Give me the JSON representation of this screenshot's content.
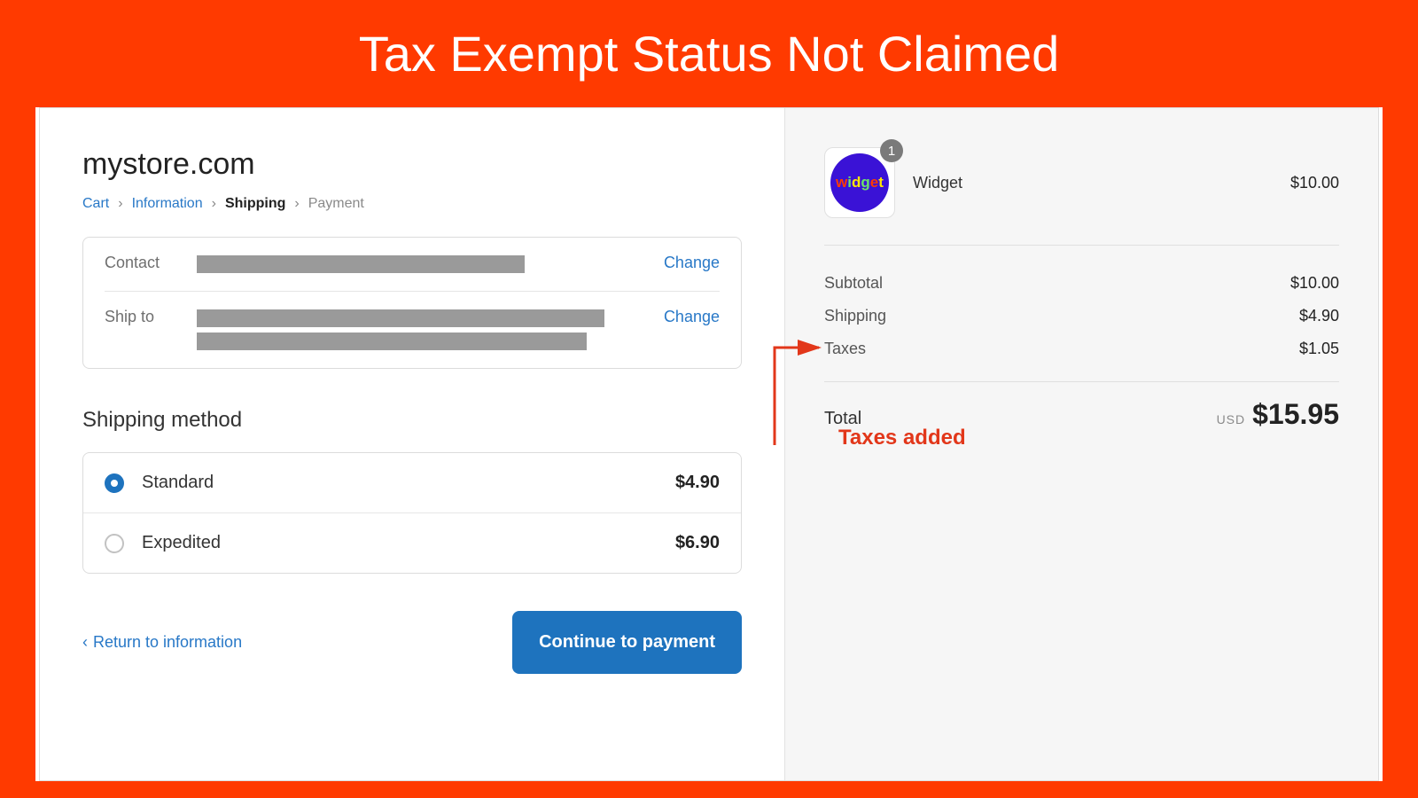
{
  "slide": {
    "title": "Tax Exempt Status Not Claimed"
  },
  "store": {
    "name": "mystore.com"
  },
  "breadcrumb": {
    "cart": "Cart",
    "information": "Information",
    "shipping": "Shipping",
    "payment": "Payment"
  },
  "info": {
    "contact_label": "Contact",
    "shipto_label": "Ship to",
    "change": "Change"
  },
  "shipping": {
    "heading": "Shipping method",
    "standard": {
      "name": "Standard",
      "price": "$4.90"
    },
    "expedited": {
      "name": "Expedited",
      "price": "$6.90"
    }
  },
  "actions": {
    "return": "Return to information",
    "continue": "Continue to payment"
  },
  "cart": {
    "badge": "1",
    "item_name": "Widget",
    "item_price": "$10.00"
  },
  "summary": {
    "subtotal_label": "Subtotal",
    "subtotal_value": "$10.00",
    "shipping_label": "Shipping",
    "shipping_value": "$4.90",
    "taxes_label": "Taxes",
    "taxes_value": "$1.05",
    "total_label": "Total",
    "currency": "USD",
    "total_value": "$15.95"
  },
  "annotation": {
    "text": "Taxes added"
  }
}
